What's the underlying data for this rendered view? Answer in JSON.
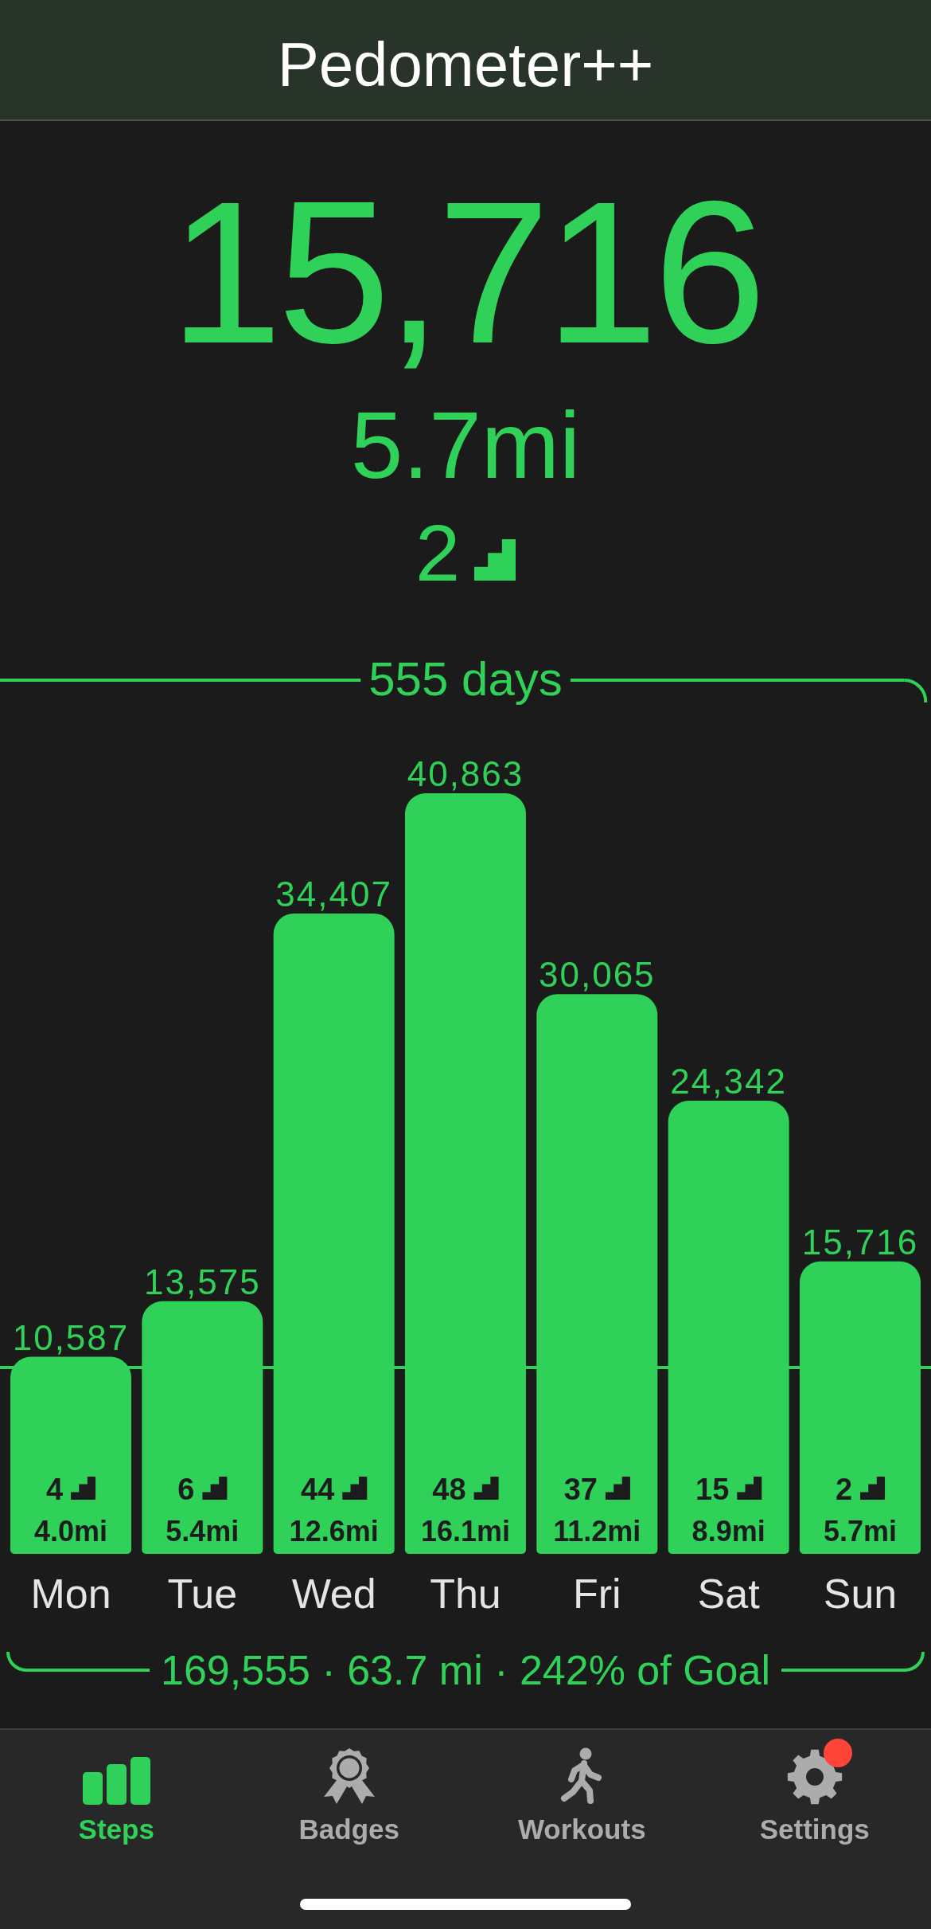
{
  "header": {
    "title": "Pedometer++"
  },
  "today": {
    "steps": "15,716",
    "distance": "5.7mi",
    "flights": "2"
  },
  "week": {
    "range_label": "555 days",
    "chart_data": {
      "type": "bar",
      "categories": [
        "Mon",
        "Tue",
        "Wed",
        "Thu",
        "Fri",
        "Sat",
        "Sun"
      ],
      "values": [
        10587,
        13575,
        34407,
        40863,
        30065,
        24342,
        15716
      ],
      "value_labels": [
        "10,587",
        "13,575",
        "34,407",
        "40,863",
        "30,065",
        "24,342",
        "15,716"
      ]
    },
    "goal_line": {
      "level": 0.245
    },
    "bar_details": [
      {
        "flights": "4",
        "distance": "4.0mi"
      },
      {
        "flights": "6",
        "distance": "5.4mi"
      },
      {
        "flights": "44",
        "distance": "12.6mi"
      },
      {
        "flights": "48",
        "distance": "16.1mi"
      },
      {
        "flights": "37",
        "distance": "11.2mi"
      },
      {
        "flights": "15",
        "distance": "8.9mi"
      },
      {
        "flights": "2",
        "distance": "5.7mi"
      }
    ],
    "summary": "169,555 · 63.7 mi · 242% of Goal"
  },
  "tabs": [
    {
      "label": "Steps",
      "selected": true,
      "notification": false
    },
    {
      "label": "Badges",
      "selected": false,
      "notification": false
    },
    {
      "label": "Workouts",
      "selected": false,
      "notification": false
    },
    {
      "label": "Settings",
      "selected": false,
      "notification": true
    }
  ]
}
